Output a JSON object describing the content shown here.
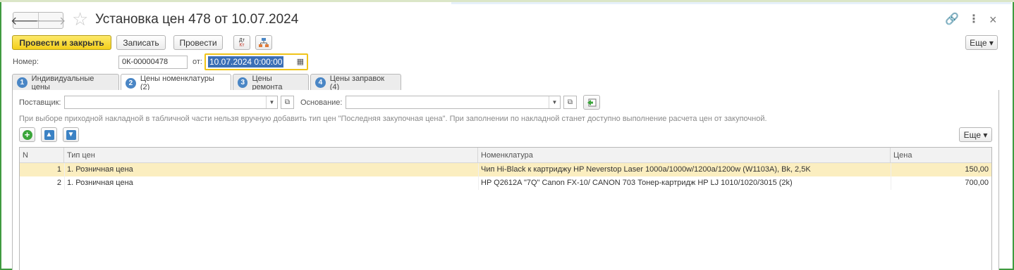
{
  "window": {
    "title": "Установка цен 478 от 10.07.2024",
    "nav_back": "🡐",
    "nav_forward": "🡒",
    "favorite_icon": "star-icon",
    "link_icon": "🔗",
    "more_icon": "⋮",
    "close_icon": "×"
  },
  "toolbar": {
    "post_close_label": "Провести и закрыть",
    "save_label": "Записать",
    "post_label": "Провести",
    "dt_kt_label": "Дт Кт",
    "more_label": "Еще ▾"
  },
  "header": {
    "number_label": "Номер:",
    "number_value": "0К-00000478",
    "date_label": "от:",
    "date_value": "10.07.2024  0:00:00"
  },
  "tabs": [
    {
      "num": "1",
      "label": "Индивидуальные цены"
    },
    {
      "num": "2",
      "label": "Цены номенклатуры (2)"
    },
    {
      "num": "3",
      "label": "Цены ремонта"
    },
    {
      "num": "4",
      "label": "Цены заправок (4)"
    }
  ],
  "filters": {
    "supplier_label": "Поставщик:",
    "supplier_value": "",
    "basis_label": "Основание:",
    "basis_value": ""
  },
  "hint": "При выборе приходной накладной в табличной части нельзя вручную добавить тип цен \"Последняя закупочная цена\". При заполнении по накладной станет доступно выполнение расчета цен от закупочной.",
  "table_toolbar": {
    "more_label": "Еще ▾"
  },
  "table": {
    "columns": [
      "N",
      "Тип цен",
      "Номенклатура",
      "Цена"
    ],
    "rows": [
      {
        "n": "1",
        "price_type": "1. Розничная цена",
        "item": "Чип Hi-Black к картриджу HP Neverstop Laser 1000a/1000w/1200a/1200w (W1103A), Bk, 2,5K",
        "price": "150,00"
      },
      {
        "n": "2",
        "price_type": "1. Розничная цена",
        "item": "HP Q2612A \"7Q\" Canon FX-10/ CANON 703 Тонер-картридж HP LJ 1010/1020/3015 (2k)",
        "price": "700,00"
      }
    ]
  },
  "colors": {
    "accent_yellow": "#f4cf1a",
    "selection_row": "#fbeec0",
    "tab_number": "#4a86c5",
    "frame_green": "#3f9a3f"
  }
}
